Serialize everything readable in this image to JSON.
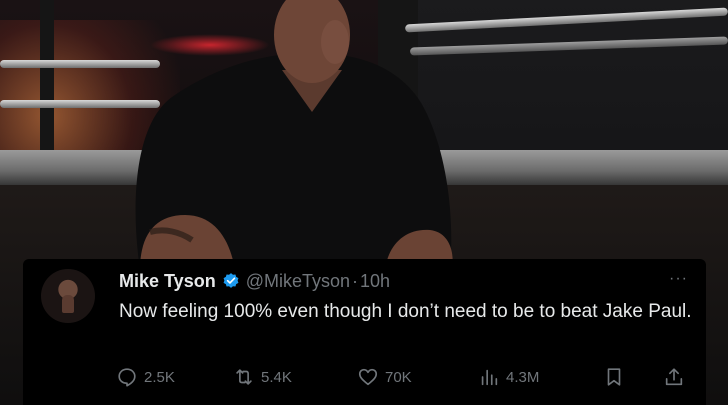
{
  "tweet": {
    "name": "Mike Tyson",
    "handle": "@MikeTyson",
    "separator": "·",
    "time": "10h",
    "more": "···",
    "text": "Now feeling 100% even though I don’t need to be to beat Jake Paul.",
    "replies": "2.5K",
    "reposts": "5.4K",
    "likes": "70K",
    "views": "4.3M"
  },
  "icons": [
    "verified-badge-icon",
    "more-icon",
    "reply-icon",
    "repost-icon",
    "like-icon",
    "views-icon",
    "bookmark-icon",
    "share-icon"
  ],
  "colors": {
    "background": "#000000",
    "primary_text": "#e7e9ea",
    "secondary_text": "#71767b",
    "verified": "#1d9bf0"
  }
}
